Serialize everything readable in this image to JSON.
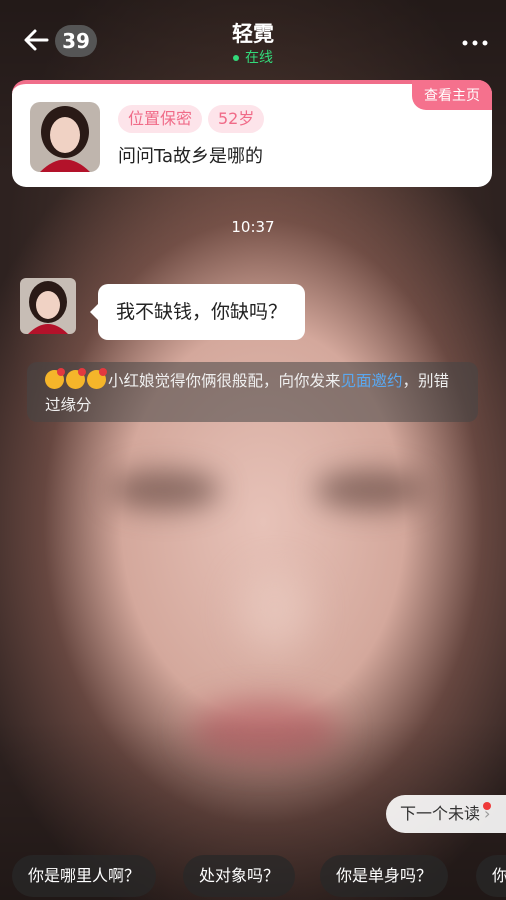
{
  "header": {
    "back_icon": "arrow-left-icon",
    "unread_count": "39",
    "title": "轻霓",
    "status": "在线",
    "more_icon": "more-dots-icon",
    "status_color": "#33d97a"
  },
  "profile_card": {
    "view_profile_label": "查看主页",
    "tags": [
      "位置保密",
      "52岁"
    ],
    "question": "问问Ta故乡是哪的",
    "accent_color": "#f06e8a"
  },
  "chat": {
    "timestamp": "10:37",
    "messages": [
      {
        "text": "我不缺钱，你缺吗？"
      }
    ],
    "system_notice": {
      "text_before": "小红娘觉得你俩很般配，向你发来",
      "link_text": "见面邀约",
      "text_after": "，别错过缘分"
    }
  },
  "next_unread": {
    "label": "下一个未读",
    "icon": "chevron-right-icon"
  },
  "quick_replies": [
    "你是哪里人啊？",
    "处对象吗？",
    "你是单身吗？",
    "你"
  ]
}
